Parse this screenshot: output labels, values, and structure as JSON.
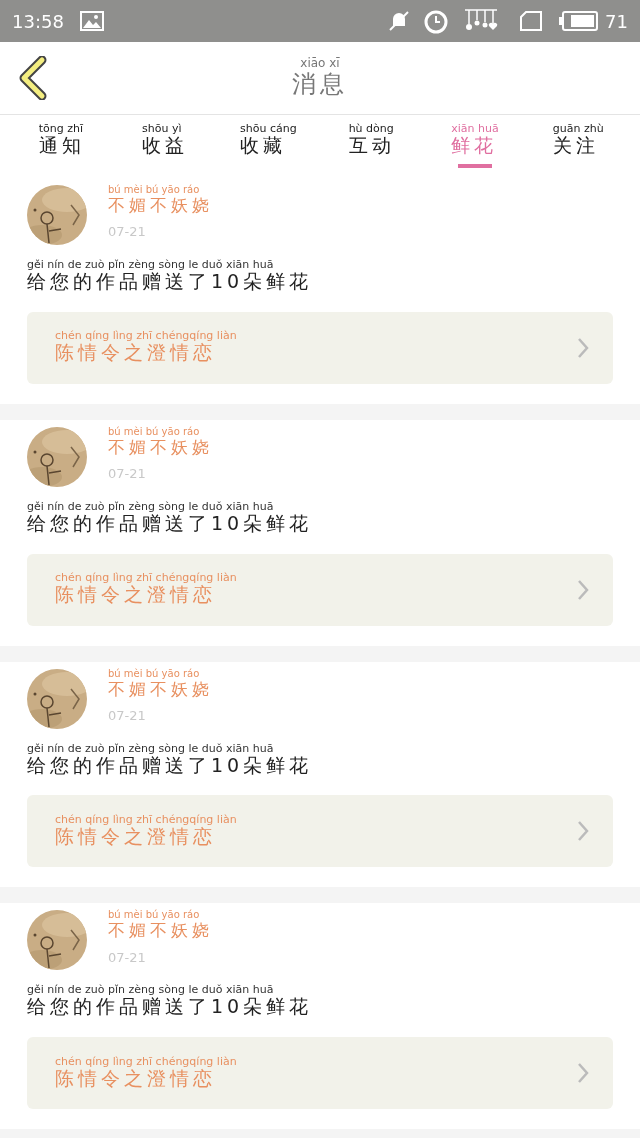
{
  "status_bar": {
    "time": "13:58",
    "battery": "71"
  },
  "header": {
    "title": "消息",
    "title_pinyin": "xiāo xī"
  },
  "tabs": [
    {
      "label": "通知",
      "pinyin": "tōng zhī",
      "selected": false
    },
    {
      "label": "收益",
      "pinyin": "shōu yì",
      "selected": false
    },
    {
      "label": "收藏",
      "pinyin": "shōu cáng",
      "selected": false
    },
    {
      "label": "互动",
      "pinyin": "hù dòng",
      "selected": false
    },
    {
      "label": "鲜花",
      "pinyin": "xiān huā",
      "selected": true
    },
    {
      "label": "关注",
      "pinyin": "guān zhù",
      "selected": false
    }
  ],
  "notifications": [
    {
      "user": "不媚不妖娆",
      "user_pinyin": "bú mèi bú yāo ráo",
      "date": "07-21",
      "message": "给您的作品赠送了10朵鲜花",
      "message_pinyin": "gěi nín de zuò pǐn zèng sòng le duǒ xiān huā",
      "work": "陈情令之澄情恋",
      "work_pinyin": "chén qíng lìng zhī chéngqíng liàn"
    },
    {
      "user": "不媚不妖娆",
      "user_pinyin": "bú mèi bú yāo ráo",
      "date": "07-21",
      "message": "给您的作品赠送了10朵鲜花",
      "message_pinyin": "gěi nín de zuò pǐn zèng sòng le duǒ xiān huā",
      "work": "陈情令之澄情恋",
      "work_pinyin": "chén qíng lìng zhī chéngqíng liàn"
    },
    {
      "user": "不媚不妖娆",
      "user_pinyin": "bú mèi bú yāo ráo",
      "date": "07-21",
      "message": "给您的作品赠送了10朵鲜花",
      "message_pinyin": "gěi nín de zuò pǐn zèng sòng le duǒ xiān huā",
      "work": "陈情令之澄情恋",
      "work_pinyin": "chén qíng lìng zhī chéngqíng liàn"
    },
    {
      "user": "不媚不妖娆",
      "user_pinyin": "bú mèi bú yāo ráo",
      "date": "07-21",
      "message": "给您的作品赠送了10朵鲜花",
      "message_pinyin": "gěi nín de zuò pǐn zèng sòng le duǒ xiān huā",
      "work": "陈情令之澄情恋",
      "work_pinyin": "chén qíng lìng zhī chéngqíng liàn"
    }
  ]
}
